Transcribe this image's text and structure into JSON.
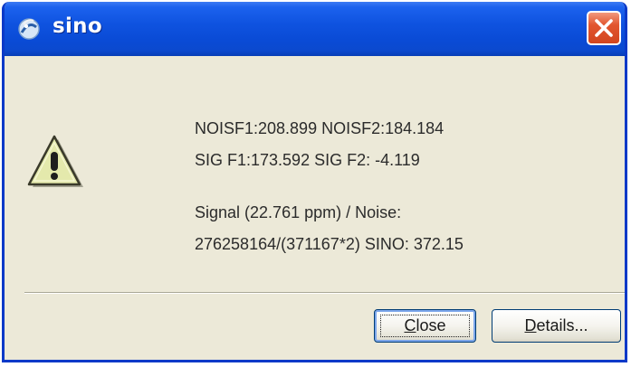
{
  "window": {
    "title": "sino",
    "title_icon": "java-app-icon",
    "close_icon": "close-icon"
  },
  "dialog": {
    "icon": "warning-icon",
    "message_lines": [
      "NOISF1:208.899 NOISF2:184.184",
      "SIG F1:173.592 SIG F2: -4.119",
      "",
      "Signal (22.761 ppm) / Noise:",
      "276258164/(371167*2) SINO: 372.15"
    ]
  },
  "buttons": {
    "close": {
      "mnemonic": "C",
      "rest": "lose",
      "default": true
    },
    "details": {
      "mnemonic": "D",
      "rest": "etails..."
    }
  },
  "colors": {
    "titlebar": "#0a4bd6",
    "close_button": "#e2562f",
    "dialog_background": "#ece9d8",
    "warning_fill": "#e4e9ac"
  }
}
